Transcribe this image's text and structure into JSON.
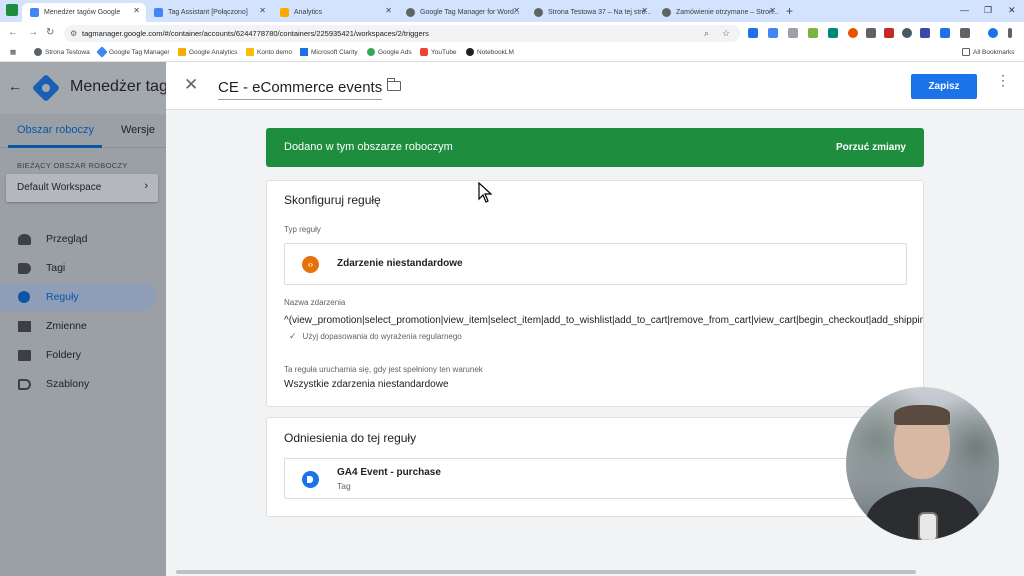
{
  "browser": {
    "tabs": [
      {
        "title": "Menedżer tagów Google",
        "active": true,
        "color": "#4285f4"
      },
      {
        "title": "Tag Assistant [Połączono]",
        "active": false,
        "color": "#4285f4"
      },
      {
        "title": "Analytics",
        "active": false,
        "color": "#f9ab00"
      },
      {
        "title": "Google Tag Manager for Word...",
        "active": false,
        "color": "#5f6368"
      },
      {
        "title": "Strona Testowa 37 – Na tej stro...",
        "active": false,
        "color": "#5f6368"
      },
      {
        "title": "Zamówienie otrzymane – Stron...",
        "active": false,
        "color": "#5f6368"
      }
    ],
    "url": "tagmanager.google.com/#/container/accounts/6244778780/containers/225935421/workspaces/2/triggers",
    "bookmarks": [
      {
        "label": "Strona Testowa",
        "color": "#5f6368"
      },
      {
        "label": "Google Tag Manager",
        "color": "#4285f4"
      },
      {
        "label": "Google Analytics",
        "color": "#f9ab00"
      },
      {
        "label": "Konto demo",
        "color": "#fbbc04"
      },
      {
        "label": "Microsoft Clarity",
        "color": "#1a73e8"
      },
      {
        "label": "Google Ads",
        "color": "#34a853"
      },
      {
        "label": "YouTube",
        "color": "#ea4335"
      },
      {
        "label": "NotebookLM",
        "color": "#202124"
      }
    ],
    "all_bookmarks": "All Bookmarks"
  },
  "sidebar": {
    "title": "Menedżer tag",
    "tabs": [
      "Obszar roboczy",
      "Wersje"
    ],
    "workspace_label": "BIEŻĄCY OBSZAR ROBOCZY",
    "workspace_name": "Default Workspace",
    "nav": [
      {
        "label": "Przegląd",
        "icon": "overview-icon",
        "active": false
      },
      {
        "label": "Tagi",
        "icon": "tag-icon",
        "active": false
      },
      {
        "label": "Reguły",
        "icon": "trigger-icon",
        "active": true
      },
      {
        "label": "Zmienne",
        "icon": "variable-icon",
        "active": false
      },
      {
        "label": "Foldery",
        "icon": "folder-icon",
        "active": false
      },
      {
        "label": "Szablony",
        "icon": "template-icon",
        "active": false
      }
    ]
  },
  "editor": {
    "trigger_name": "CE - eCommerce events",
    "save_label": "Zapisz",
    "banner_text": "Dodano w tym obszarze roboczym",
    "banner_action": "Porzuć zmiany",
    "config_title": "Skonfiguruj regułę",
    "type_label": "Typ reguły",
    "type_name": "Zdarzenie niestandardowe",
    "event_name_label": "Nazwa zdarzenia",
    "event_name_value": "^(view_promotion|select_promotion|view_item|select_item|add_to_wishlist|add_to_cart|remove_from_cart|view_cart|begin_checkout|add_shipping_info|add_paym",
    "regex_label": "Użyj dopasowania do wyrażenia regularnego",
    "condition_label": "Ta reguła uruchamia się, gdy jest spełniony ten warunek",
    "condition_value": "Wszystkie zdarzenia niestandardowe",
    "references_title": "Odniesienia do tej reguły",
    "reference_name": "GA4 Event - purchase",
    "reference_type": "Tag"
  },
  "colors": {
    "accent": "#1a73e8",
    "banner": "#1e8e3e",
    "trigger_type": "#e8710a"
  }
}
